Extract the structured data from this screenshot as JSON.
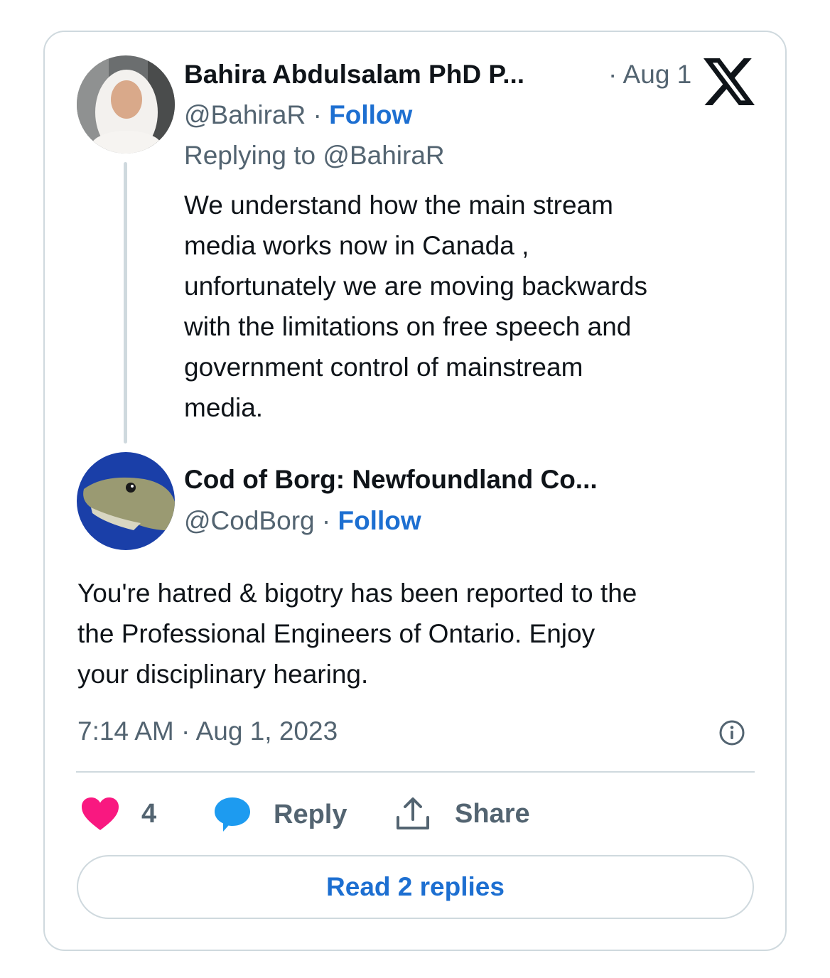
{
  "parent_tweet": {
    "display_name": "Bahira Abdulsalam PhD P...",
    "handle": "@BahiraR",
    "separator": "·",
    "follow_label": "Follow",
    "date": "· Aug 1",
    "replying_to": "Replying to @BahiraR",
    "text": "We understand how the main stream\nmedia works now in Canada ,\nunfortunately we are moving backwards\nwith the limitations on free speech and\ngovernment control of mainstream\nmedia."
  },
  "reply_tweet": {
    "display_name": "Cod of Borg: Newfoundland Co...",
    "handle": "@CodBorg",
    "separator": "·",
    "follow_label": "Follow",
    "text": "You're hatred & bigotry has been reported to the\nthe Professional Engineers of Ontario.  Enjoy\nyour disciplinary hearing.",
    "timestamp": "7:14 AM · Aug 1, 2023"
  },
  "actions": {
    "like_count": "4",
    "reply_label": "Reply",
    "share_label": "Share"
  },
  "read_replies_label": "Read 2 replies",
  "colors": {
    "link_blue": "#1d6fd1",
    "like_pink": "#f91880",
    "reply_bubble": "#1d9bf0",
    "muted_text": "#536471",
    "border": "#cfd9de"
  }
}
